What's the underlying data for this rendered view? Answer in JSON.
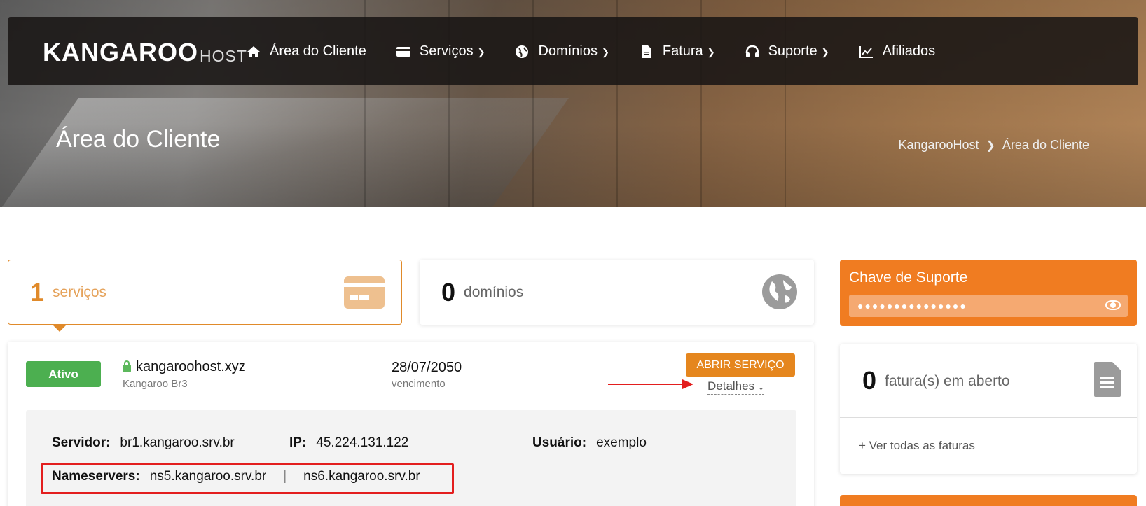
{
  "nav": {
    "logo_main": "KANGAROO",
    "logo_sub": "HOST",
    "items": [
      {
        "label": "Área do Cliente",
        "icon": "home-icon",
        "dropdown": false
      },
      {
        "label": "Serviços",
        "icon": "credit-card-icon",
        "dropdown": true
      },
      {
        "label": "Domínios",
        "icon": "globe-icon",
        "dropdown": true
      },
      {
        "label": "Fatura",
        "icon": "document-icon",
        "dropdown": true
      },
      {
        "label": "Suporte",
        "icon": "headset-icon",
        "dropdown": true
      },
      {
        "label": "Afiliados",
        "icon": "chart-icon",
        "dropdown": false
      }
    ]
  },
  "hero": {
    "title": "Área do Cliente",
    "breadcrumb": [
      "KangarooHost",
      "Área do Cliente"
    ]
  },
  "stats": {
    "services": {
      "count": "1",
      "label": "serviços"
    },
    "domains": {
      "count": "0",
      "label": "domínios"
    }
  },
  "service": {
    "status": "Ativo",
    "domain": "kangaroohost.xyz",
    "plan": "Kangaroo Br3",
    "due_date": "28/07/2050",
    "due_label": "vencimento",
    "open_button": "ABRIR SERVIÇO",
    "details_link": "Detalhes",
    "details": {
      "server_label": "Servidor:",
      "server": "br1.kangaroo.srv.br",
      "ip_label": "IP:",
      "ip": "45.224.131.122",
      "user_label": "Usuário:",
      "user": "exemplo",
      "ns_label": "Nameservers:",
      "ns1": "ns5.kangaroo.srv.br",
      "ns_sep": "|",
      "ns2": "ns6.kangaroo.srv.br"
    }
  },
  "support_key": {
    "title": "Chave de Suporte",
    "masked": "●●●●●●●●●●●●●●●"
  },
  "invoices": {
    "count": "0",
    "label": "fatura(s) em aberto",
    "link": "+ Ver todas as faturas"
  },
  "colors": {
    "accent": "#e5861e",
    "support": "#f07c21",
    "status_active": "#4caf50",
    "annotation": "#e31e1e"
  }
}
